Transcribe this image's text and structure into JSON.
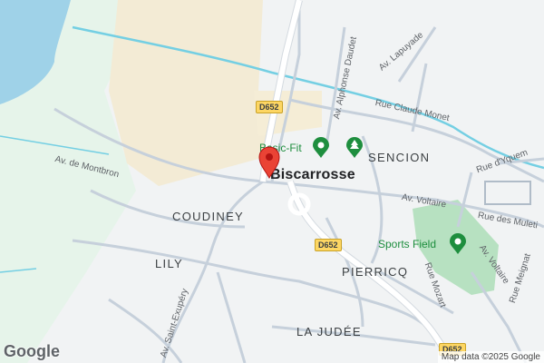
{
  "map": {
    "city_label": "Biscarrosse",
    "places": [
      "SENCION",
      "COUDINEY",
      "LILY",
      "PIERRICQ",
      "LA JUDÉE"
    ],
    "streets": [
      "Av. de Montbron",
      "Av. Alphonse Daudet",
      "Av. Lapuyade",
      "Rue Claude Monet",
      "Rue d'Yquem",
      "Av. Voltaire",
      "Rue des Muleti",
      "Av. Voltaire",
      "Rue Mozart",
      "Av. Saint-Exupéry",
      "Rue Meignat"
    ],
    "route_badges": [
      "D652",
      "D652",
      "D652"
    ],
    "pois": [
      {
        "label": "Basic-Fit",
        "icon": "fitness-pin-icon"
      },
      {
        "label": "",
        "icon": "park-pin-icon"
      },
      {
        "label": "Sports Field",
        "icon": "sports-field-pin-icon"
      }
    ],
    "marker": {
      "icon": "red-location-pin-icon"
    },
    "logo": "Google",
    "attribution": "Map data ©2025 Google",
    "colors": {
      "water": "#9fd2e8",
      "park": "#c8ebcf",
      "sand": "#f3ebd5",
      "road": "#ffffff",
      "road_minor": "#c6d0db",
      "canal": "#74cfe3",
      "marker": "#ea4335",
      "poi": "#1e8e3e",
      "route_badge": "#fdd663"
    }
  }
}
